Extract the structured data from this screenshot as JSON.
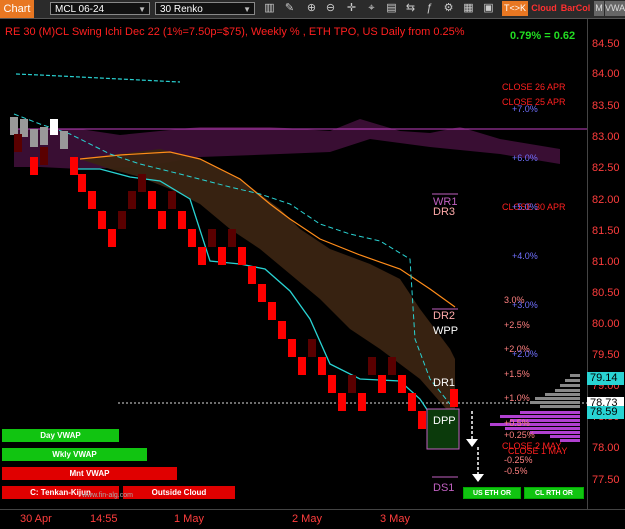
{
  "toolbar": {
    "title": "Chart",
    "symbol": "MCL 06-24",
    "bar_type": "30 Renko",
    "tk_label": "T<>K",
    "cloud_label": "Cloud",
    "barcol_label": "BarCol",
    "m_label": "M",
    "vwap_label": "VWA"
  },
  "header": {
    "title": "RE 30 (M)CL Swing Ichi Dec 22  (1%=7.50p=$75), Weekly % , ETH TPO, US Daily from 0.25%",
    "pct_readout": "0.79% = 0.62"
  },
  "price_axis": [
    "84.50",
    "84.00",
    "83.50",
    "83.00",
    "82.50",
    "82.00",
    "81.50",
    "81.00",
    "80.50",
    "80.00",
    "79.50",
    "79.00",
    "78.50",
    "78.00",
    "77.50"
  ],
  "price_tags": {
    "cyan": "79.14",
    "white": "78.73",
    "cyan2": "78.59"
  },
  "time_axis": [
    "30 Apr",
    "14:55",
    "1 May",
    "2 May",
    "3 May"
  ],
  "annotations": {
    "close_26apr": "CLOSE 26 APR",
    "close_25apr": "CLOSE 25 APR",
    "close_30apr": "CLOSE 30 APR",
    "close_2may": "CLOSE 2 MAY",
    "close_1may": "CLOSE 1 MAY",
    "p7": "+7.0%",
    "p6": "+6.0%",
    "p5": "+5.0%",
    "p4": "+4.0%",
    "p3": "+3.0%",
    "p2": "+2.0%",
    "p2b": "+2.0%",
    "p3b": "3.0%",
    "p25": "+2.5%",
    "p15": "+1.5%",
    "p1": "+1.0%",
    "p05": "+0.5%",
    "p025": "+0.25%",
    "m025": "-0.25%",
    "m05": "-0.5%",
    "wr1": "WR1",
    "dr3": "DR3",
    "dr2": "DR2",
    "wpp": "WPP",
    "dr1": "DR1",
    "dpp": "DPP",
    "ds1": "DS1"
  },
  "vwap_buttons": {
    "day": "Day VWAP",
    "wkly": "Wkly VWAP",
    "mnt": "Mnt VWAP",
    "tenkan": "C: Tenkan-Kijun",
    "cloud": "Outside Cloud",
    "watermark": "www.fin-alg.com"
  },
  "session_buttons": {
    "eth": "US ETH OR",
    "rth": "CL RTH OR"
  },
  "colors": {
    "up_brick": "#5a0000",
    "down_brick": "#ff0000",
    "cloud_bear": "#3a2412",
    "cloud_bull": "#3c0f36",
    "cyan": "#29d3d3",
    "orange": "#ff8c1a",
    "accent": "#e87722"
  }
}
